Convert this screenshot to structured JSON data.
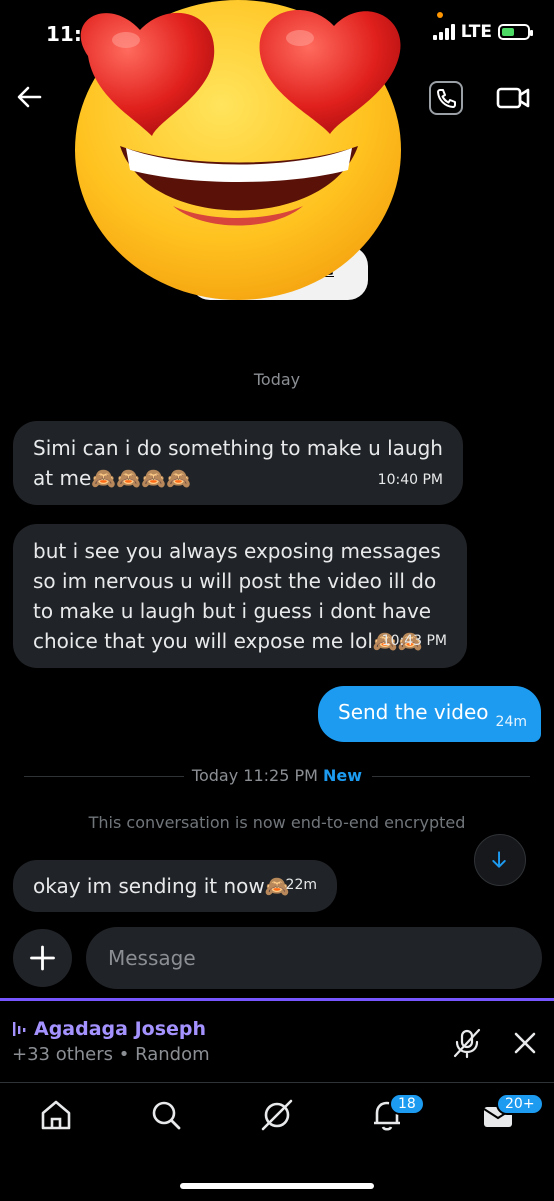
{
  "status_bar": {
    "time": "11:",
    "network": "LTE"
  },
  "header": {
    "back_icon": "arrow-left-icon",
    "call_icon": "phone-icon",
    "video_icon": "video-camera-icon",
    "profile_button_label": "ne"
  },
  "sticker": {
    "name": "heart-eyes-emoji"
  },
  "conversation": {
    "date_separator": "Today",
    "messages": [
      {
        "text": "Simi can i do something to make u laugh at me🙈🙈🙈🙈",
        "time": "10:40 PM"
      },
      {
        "text": "but i see you always exposing messages so im nervous u will post the video ill do to make u laugh but i guess i dont have choice that you will expose me lol🙈🙈",
        "time": "10:43 PM"
      }
    ],
    "sent": {
      "text": "Send the video",
      "time": "24m"
    },
    "new_separator": {
      "label": "Today 11:25 PM",
      "new_label": "New"
    },
    "encryption_notice": "This conversation is now end-to-end encrypted",
    "latest": {
      "text": "okay im sending it now🙈",
      "time": "22m"
    }
  },
  "composer": {
    "placeholder": "Message"
  },
  "space": {
    "host": "Agadaga Joseph",
    "subtitle": "+33 others • Random"
  },
  "tabbar": {
    "notifications_badge": "18",
    "messages_badge": "20+"
  },
  "colors": {
    "accent": "#1d9bf0",
    "space": "#7856ff"
  }
}
